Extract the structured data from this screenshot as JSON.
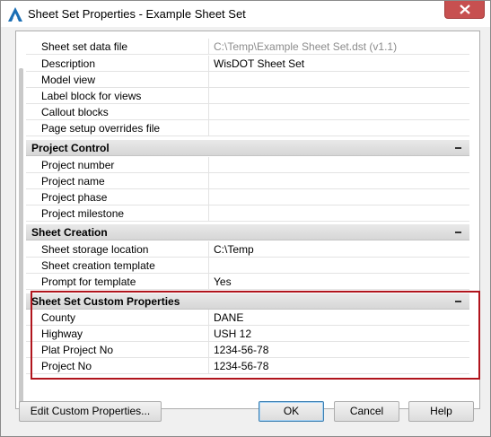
{
  "window": {
    "title": "Sheet Set Properties - Example Sheet Set",
    "app_icon": "autocad-a-icon",
    "close_icon": "close-icon"
  },
  "sections": [
    {
      "rows": [
        {
          "label": "Sheet set data file",
          "value": "C:\\Temp\\Example Sheet Set.dst (v1.1)",
          "muted": true
        },
        {
          "label": "Description",
          "value": "WisDOT Sheet Set"
        },
        {
          "label": "Model view",
          "value": ""
        },
        {
          "label": "Label block for views",
          "value": ""
        },
        {
          "label": "Callout blocks",
          "value": ""
        },
        {
          "label": "Page setup overrides file",
          "value": ""
        }
      ]
    },
    {
      "title": "Project Control",
      "rows": [
        {
          "label": "Project number",
          "value": ""
        },
        {
          "label": "Project name",
          "value": ""
        },
        {
          "label": "Project phase",
          "value": ""
        },
        {
          "label": "Project milestone",
          "value": ""
        }
      ]
    },
    {
      "title": "Sheet Creation",
      "rows": [
        {
          "label": "Sheet storage location",
          "value": "C:\\Temp"
        },
        {
          "label": "Sheet creation template",
          "value": ""
        },
        {
          "label": "Prompt for template",
          "value": "Yes"
        }
      ]
    },
    {
      "title": "Sheet Set Custom Properties",
      "rows": [
        {
          "label": "County",
          "value": "DANE"
        },
        {
          "label": "Highway",
          "value": "USH 12"
        },
        {
          "label": "Plat Project No",
          "value": "1234-56-78"
        },
        {
          "label": "Project No",
          "value": "1234-56-78"
        }
      ]
    }
  ],
  "buttons": {
    "edit_custom": "Edit Custom Properties...",
    "ok": "OK",
    "cancel": "Cancel",
    "help": "Help"
  },
  "colors": {
    "highlight_border": "#b0141c",
    "close_button": "#c75050",
    "muted_text": "#8c8c8c"
  }
}
